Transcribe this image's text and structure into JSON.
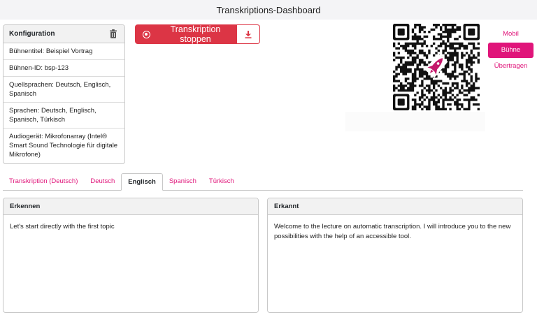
{
  "window": {
    "title": "Transkriptions-Dashboard"
  },
  "config": {
    "title": "Konfiguration",
    "delete_icon": "trash-icon",
    "rows": [
      "Bühnentitel: Beispiel Vortrag",
      "Bühnen-ID: bsp-123",
      "Quellsprachen: Deutsch, Englisch, Spanisch",
      "Sprachen: Deutsch, Englisch, Spanisch, Türkisch",
      "Audiogerät: Mikrofonarray (Intel® Smart Sound Technologie für digitale Mikrofone)"
    ]
  },
  "actions": {
    "stop_label": "Transkription stoppen",
    "stop_icon": "record-icon",
    "download_icon": "download-icon",
    "danger_color": "#dc3545"
  },
  "qr": {
    "icon": "qr-code",
    "logo": "rocket-icon"
  },
  "views": {
    "items": [
      "Mobil",
      "Bühne",
      "Übertragen"
    ],
    "active": "Bühne",
    "accent_color": "#e0157a"
  },
  "tabs": {
    "items": [
      "Transkription (Deutsch)",
      "Deutsch",
      "Englisch",
      "Spanisch",
      "Türkisch"
    ],
    "active": "Englisch"
  },
  "panels": {
    "recognizing": {
      "title": "Erkennen",
      "text": "Let's start directly with the first topic"
    },
    "recognized": {
      "title": "Erkannt",
      "text": "Welcome to the lecture on automatic transcription. I will introduce you to the new possibilities with the help of an accessible tool."
    }
  }
}
